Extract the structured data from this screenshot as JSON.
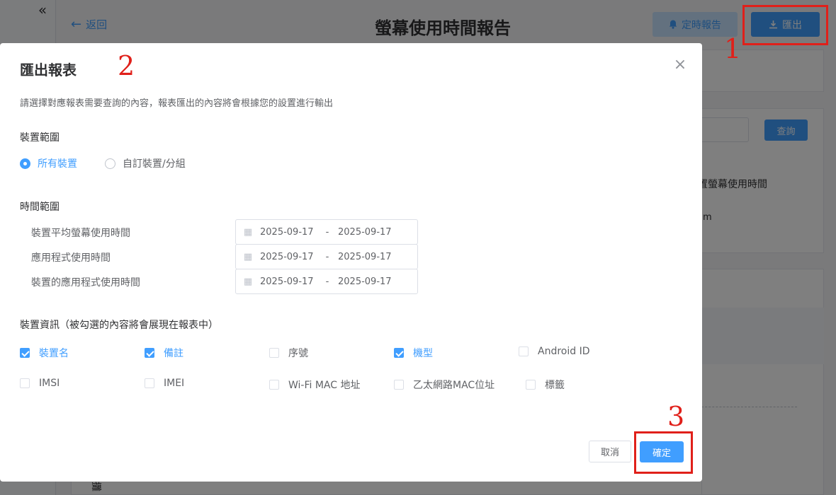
{
  "page": {
    "back_label": "返回",
    "title": "螢幕使用時間報告",
    "schedule_label": "定時報告",
    "export_label": "匯出",
    "query_label": "查詢",
    "bg_text_1": "置螢幕使用時間",
    "bg_text_2": "m",
    "bg_bottom_glyph": "攤"
  },
  "annotations": {
    "step1": "1",
    "step2": "2",
    "step3": "3",
    "highlight_color": "#e0201a"
  },
  "modal": {
    "title": "匯出報表",
    "description": "請選擇對應報表需要查詢的內容，報表匯出的內容將會根據您的設置進行輸出",
    "device_scope": {
      "label": "裝置範圍",
      "options": [
        {
          "label": "所有裝置",
          "selected": true
        },
        {
          "label": "自訂裝置/分組",
          "selected": false
        }
      ]
    },
    "time_scope": {
      "label": "時間範圍",
      "rows": [
        {
          "label": "裝置平均螢幕使用時間",
          "start": "2025-09-17",
          "end": "2025-09-17"
        },
        {
          "label": "應用程式使用時間",
          "start": "2025-09-17",
          "end": "2025-09-17"
        },
        {
          "label": "裝置的應用程式使用時間",
          "start": "2025-09-17",
          "end": "2025-09-17"
        }
      ],
      "separator": "-"
    },
    "device_info": {
      "label": "裝置資訊（被勾選的內容將會展現在報表中）",
      "fields": [
        {
          "label": "裝置名",
          "checked": true
        },
        {
          "label": "備註",
          "checked": true
        },
        {
          "label": "序號",
          "checked": false
        },
        {
          "label": "機型",
          "checked": true
        },
        {
          "label": "Android ID",
          "checked": false
        },
        {
          "label": "IMSI",
          "checked": false
        },
        {
          "label": "IMEI",
          "checked": false
        },
        {
          "label": "Wi-Fi MAC 地址",
          "checked": false
        },
        {
          "label": "乙太網路MAC位址",
          "checked": false
        },
        {
          "label": "標籤",
          "checked": false
        }
      ]
    },
    "cancel_label": "取消",
    "confirm_label": "確定"
  },
  "colors": {
    "primary": "#409eff",
    "primary_light": "#c6e2ff",
    "overlay": "rgba(0,0,0,0.5)"
  }
}
